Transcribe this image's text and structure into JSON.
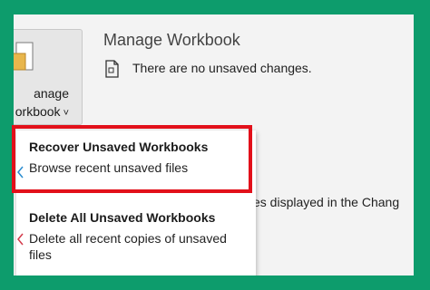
{
  "manage_button": {
    "label_line1": "anage",
    "label_line2": "orkbook",
    "chevron": "˅"
  },
  "section": {
    "title": "Manage Workbook",
    "status": "There are no unsaved changes.",
    "background_text": "es displayed in the Chang"
  },
  "menu": {
    "items": [
      {
        "title": "Recover Unsaved Workbooks",
        "description": "Browse recent unsaved files",
        "icon": "recover-icon"
      },
      {
        "title": "Delete All Unsaved Workbooks",
        "description": "Delete all recent copies of unsaved files",
        "icon": "delete-icon"
      }
    ]
  },
  "colors": {
    "frame": "#0d9c6c",
    "highlight": "#e2101a",
    "panel": "#f3f3f3"
  }
}
